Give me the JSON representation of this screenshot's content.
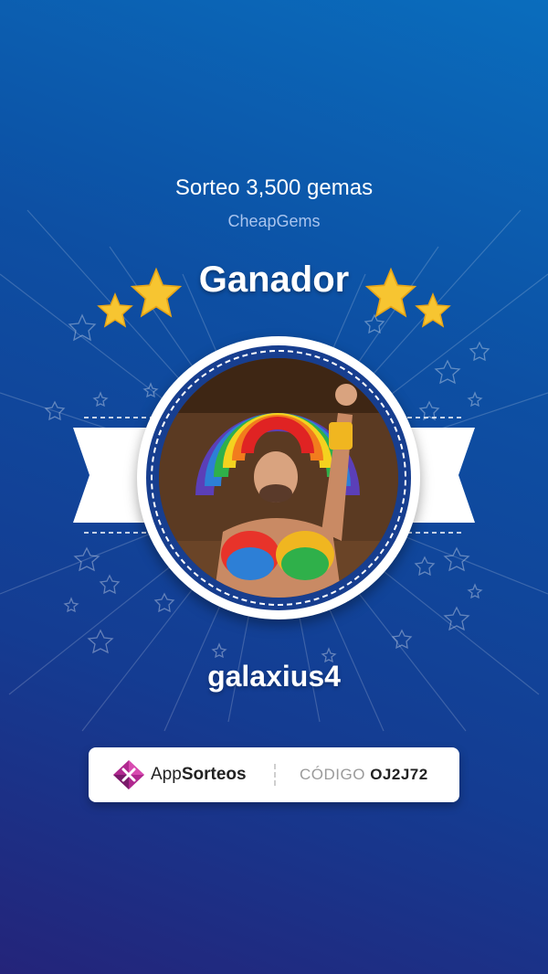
{
  "raffle": {
    "title": "Sorteo 3,500 gemas",
    "organizer": "CheapGems"
  },
  "winner": {
    "heading": "Ganador",
    "username": "galaxius4",
    "avatar_alt": "winner-avatar"
  },
  "footer": {
    "brand_prefix": "App",
    "brand_suffix": "Sorteos",
    "code_label": "CÓDIGO",
    "code_value": "OJ2J72"
  },
  "colors": {
    "background_top": "#0a6dbd",
    "background_bottom": "#24247a",
    "star_gold": "#f7c531",
    "medal_ring": "#173e8f",
    "brand_magenta": "#b0288f"
  }
}
